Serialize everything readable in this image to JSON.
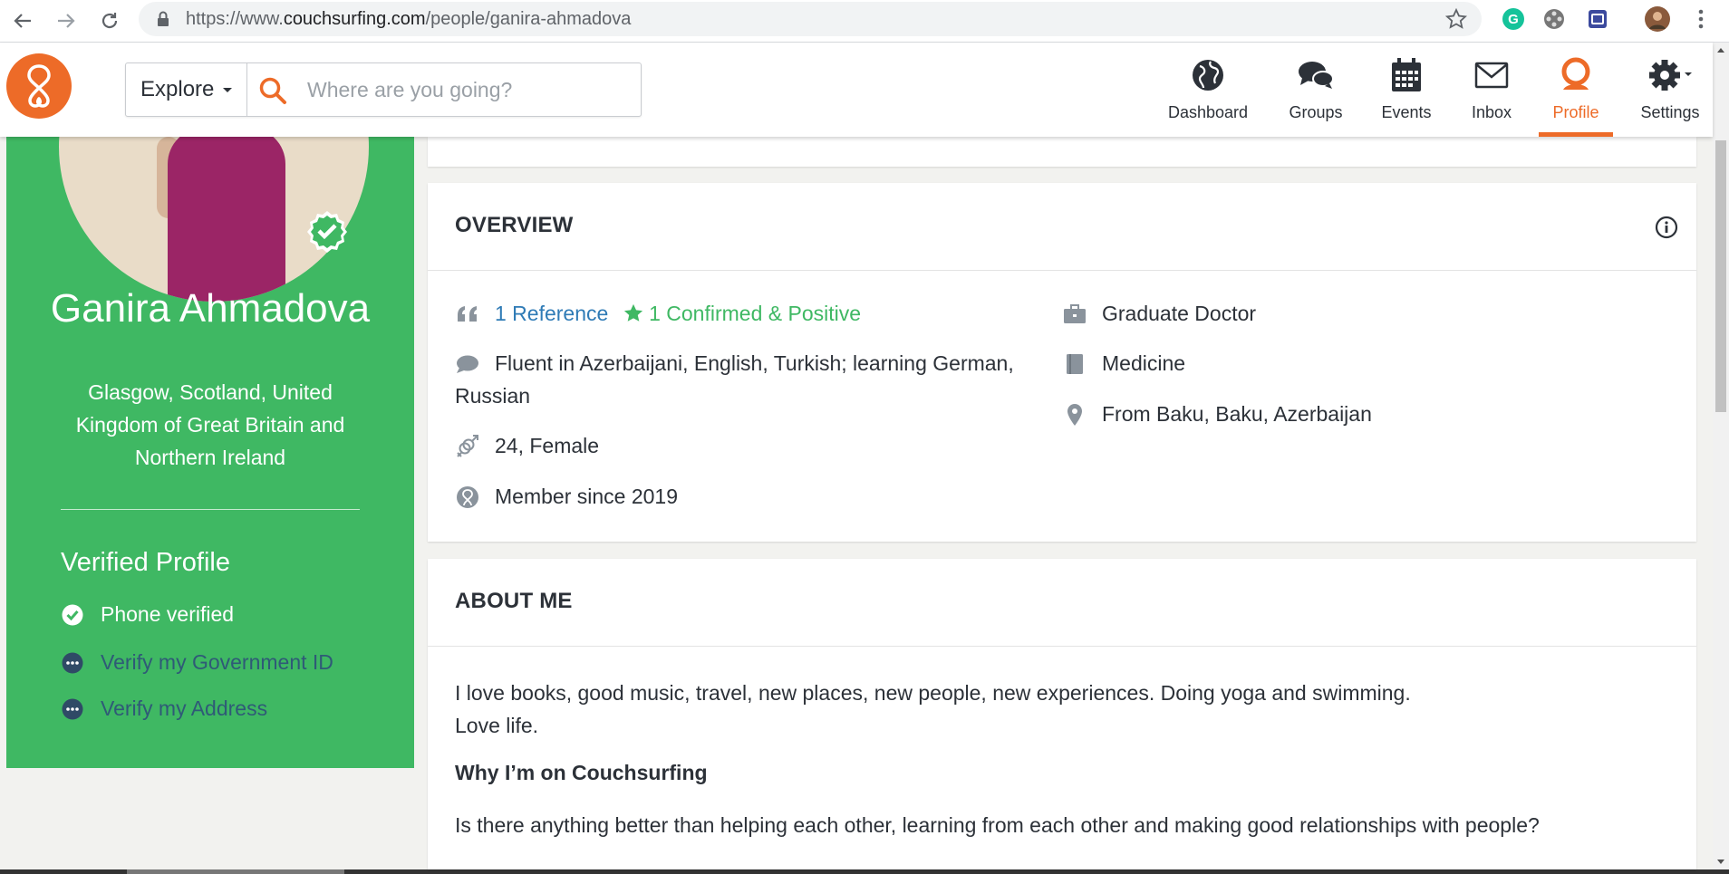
{
  "browser": {
    "url_prefix": "https://www.",
    "url_domain": "couchsurfing.com",
    "url_path": "/people/ganira-ahmadova"
  },
  "header": {
    "explore_label": "Explore",
    "search_placeholder": "Where are you going?",
    "nav": [
      {
        "label": "Dashboard",
        "icon": "globe-icon"
      },
      {
        "label": "Groups",
        "icon": "chat-bubbles-icon"
      },
      {
        "label": "Events",
        "icon": "calendar-icon"
      },
      {
        "label": "Inbox",
        "icon": "envelope-icon"
      },
      {
        "label": "Profile",
        "icon": "user-icon",
        "active": true
      },
      {
        "label": "Settings",
        "icon": "gear-icon"
      }
    ],
    "accent_color": "#ed6b28"
  },
  "profile": {
    "name": "Ganira Ahmadova",
    "location": "Glasgow, Scotland, United Kingdom of Great Britain and Northern Ireland",
    "verified_title": "Verified Profile",
    "verifications": [
      {
        "label": "Phone verified",
        "status": "verified"
      },
      {
        "label": "Verify my Government ID",
        "status": "pending"
      },
      {
        "label": "Verify my Address",
        "status": "pending"
      }
    ],
    "sidebar_color": "#3fb863"
  },
  "overview": {
    "title": "OVERVIEW",
    "references": "1 Reference",
    "confirmed": "1 Confirmed & Positive",
    "languages": "Fluent in Azerbaijani, English, Turkish; learning German, Russian",
    "age_gender": "24, Female",
    "member_since": "Member since 2019",
    "occupation": "Graduate Doctor",
    "education": "Medicine",
    "hometown": "From Baku, Baku, Azerbaijan"
  },
  "about": {
    "title": "ABOUT ME",
    "text_line1": "I love books, good music, travel, new places, new people, new experiences. Doing yoga and swimming.",
    "text_line2": "Love life.",
    "why_title": "Why I’m on Couchsurfing",
    "why_text": "Is there anything better than helping each other, learning from each other and making good relationships with people?"
  }
}
